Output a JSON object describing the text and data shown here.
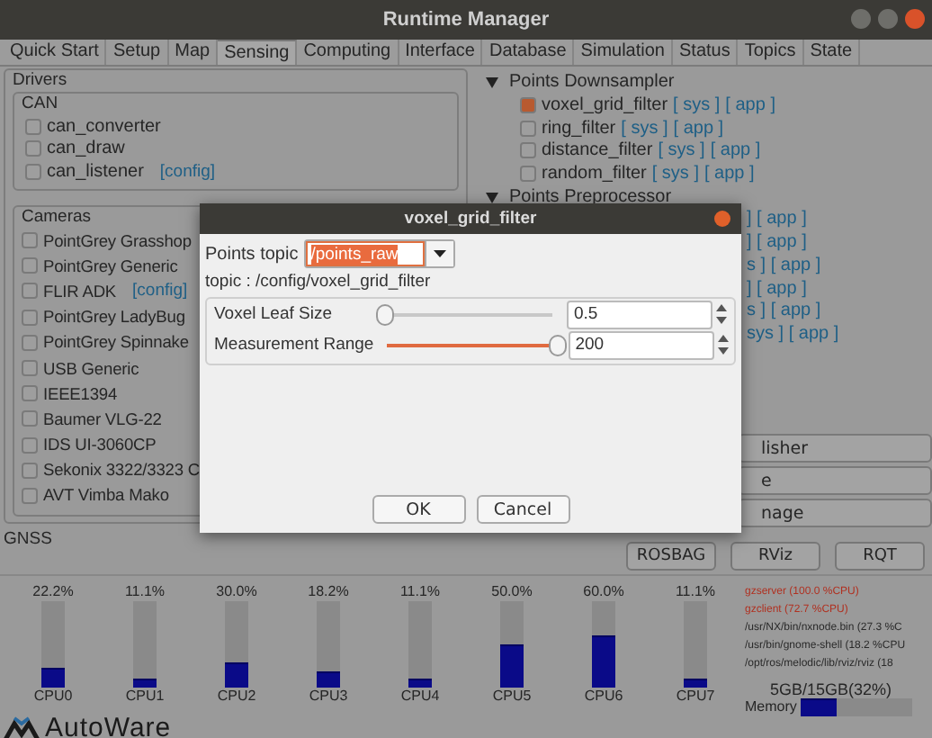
{
  "window": {
    "title": "Runtime Manager"
  },
  "tabs": [
    {
      "label": "Quick Start",
      "selected": false
    },
    {
      "label": "Setup",
      "selected": false
    },
    {
      "label": "Map",
      "selected": false
    },
    {
      "label": "Sensing",
      "selected": true
    },
    {
      "label": "Computing",
      "selected": false
    },
    {
      "label": "Interface",
      "selected": false
    },
    {
      "label": "Database",
      "selected": false
    },
    {
      "label": "Simulation",
      "selected": false
    },
    {
      "label": "Status",
      "selected": false
    },
    {
      "label": "Topics",
      "selected": false
    },
    {
      "label": "State",
      "selected": false
    }
  ],
  "drivers": {
    "title": "Drivers",
    "can": {
      "title": "CAN",
      "items": [
        {
          "label": "can_converter",
          "checked": false
        },
        {
          "label": "can_draw",
          "checked": false
        },
        {
          "label": "can_listener",
          "checked": false,
          "link": "[config]"
        }
      ]
    },
    "cameras": {
      "title": "Cameras",
      "items": [
        {
          "label": "PointGrey Grasshop",
          "checked": false
        },
        {
          "label": "PointGrey Generic",
          "checked": false
        },
        {
          "label": "FLIR ADK",
          "checked": false,
          "link": "[config]"
        },
        {
          "label": "PointGrey LadyBug",
          "checked": false
        },
        {
          "label": "PointGrey Spinnake",
          "checked": false
        },
        {
          "label": "USB Generic",
          "checked": false
        },
        {
          "label": "IEEE1394",
          "checked": false
        },
        {
          "label": "Baumer VLG-22",
          "checked": false
        },
        {
          "label": "IDS UI-3060CP",
          "checked": false
        },
        {
          "label": "Sekonix 3322/3323 C",
          "checked": false
        },
        {
          "label": "AVT Vimba Mako",
          "checked": false
        }
      ]
    }
  },
  "gnss": {
    "title": "GNSS"
  },
  "tree": [
    {
      "label": "Points Downsampler",
      "expanded": true,
      "children": [
        {
          "label": "voxel_grid_filter",
          "checked": true,
          "sys": "[ sys ]",
          "app": "[ app ]"
        },
        {
          "label": "ring_filter",
          "checked": false,
          "sys": "[ sys ]",
          "app": "[ app ]"
        },
        {
          "label": "distance_filter",
          "checked": false,
          "sys": "[ sys ]",
          "app": "[ app ]"
        },
        {
          "label": "random_filter",
          "checked": false,
          "sys": "[ sys ]",
          "app": "[ app ]"
        }
      ]
    },
    {
      "label": "Points Preprocessor",
      "expanded": true,
      "fragments": [
        "] [ app ]",
        "] [ app ]",
        "s ] [ app ]",
        "] [ app ]",
        "s ] [ app ]",
        "sys ] [ app ]"
      ]
    }
  ],
  "side_buttons": [
    "lisher",
    "e",
    "nage"
  ],
  "tool_buttons": [
    "ROSBAG",
    "RViz",
    "RQT"
  ],
  "cpus": [
    {
      "label": "CPU0",
      "reading": "22.2%",
      "level": 0.222
    },
    {
      "label": "CPU1",
      "reading": "11.1%",
      "level": 0.111
    },
    {
      "label": "CPU2",
      "reading": "30.0%",
      "level": 0.3
    },
    {
      "label": "CPU3",
      "reading": "18.2%",
      "level": 0.182
    },
    {
      "label": "CPU4",
      "reading": "11.1%",
      "level": 0.111
    },
    {
      "label": "CPU5",
      "reading": "50.0%",
      "level": 0.5
    },
    {
      "label": "CPU6",
      "reading": "60.0%",
      "level": 0.6
    },
    {
      "label": "CPU7",
      "reading": "11.1%",
      "level": 0.111
    }
  ],
  "processes": [
    {
      "text": "gzserver (100.0 %CPU)",
      "color": "#b03020"
    },
    {
      "text": "gzclient (72.7 %CPU)",
      "color": "#b03020"
    },
    {
      "text": "/usr/NX/bin/nxnode.bin (27.3 %C",
      "color": "#2a2a2a"
    },
    {
      "text": "/usr/bin/gnome-shell (18.2 %CPU",
      "color": "#2a2a2a"
    },
    {
      "text": "/opt/ros/melodic/lib/rviz/rviz (18",
      "color": "#2a2a2a"
    }
  ],
  "memory": {
    "reading": "5GB/15GB(32%)",
    "label": "Memory",
    "level": 0.32
  },
  "logo": {
    "text": "AutoWare"
  },
  "dialog": {
    "title": "voxel_grid_filter",
    "topic_label": "Points topic",
    "topic_value": "/points_raw",
    "group": "topic : /config/voxel_grid_filter",
    "params": [
      {
        "label": "Voxel Leaf Size",
        "level": 0.0,
        "value": "0.5"
      },
      {
        "label": "Measurement Range",
        "level": 1.0,
        "value": "200"
      }
    ],
    "buttons": [
      "OK",
      "Cancel"
    ]
  }
}
